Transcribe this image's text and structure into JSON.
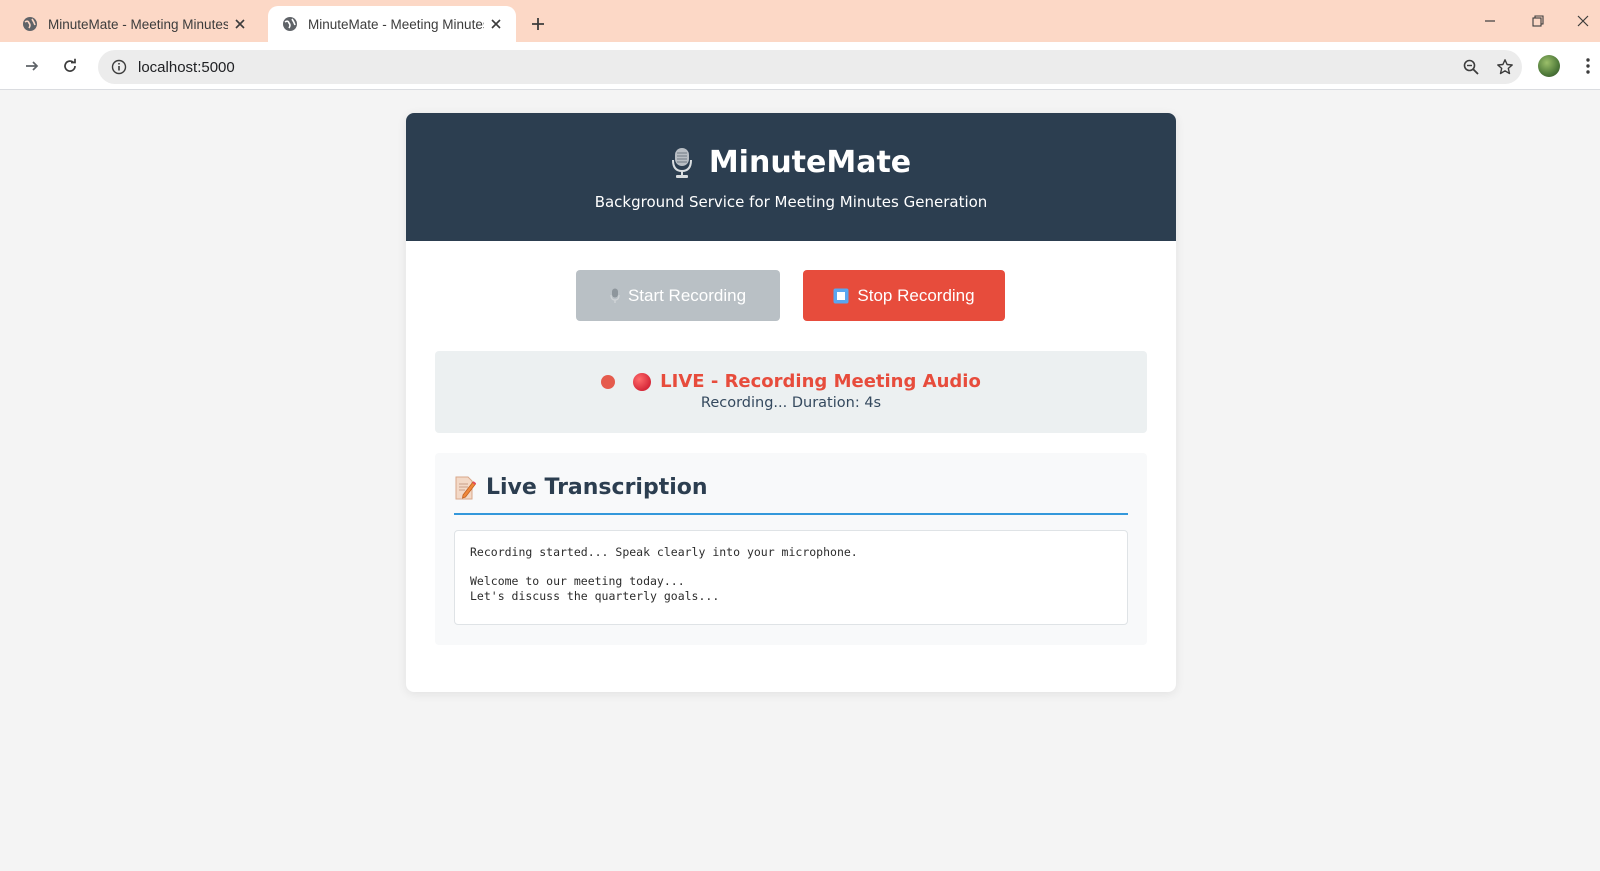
{
  "browser": {
    "tabs": [
      {
        "title": "MinuteMate - Meeting Minutes",
        "active": false
      },
      {
        "title": "MinuteMate - Meeting Minutes",
        "active": true
      }
    ],
    "url": "localhost:5000"
  },
  "app": {
    "title": "MinuteMate",
    "subtitle": "Background Service for Meeting Minutes Generation",
    "start_label": "Start Recording",
    "stop_label": "Stop Recording",
    "status": {
      "live_text": "LIVE - Recording Meeting Audio",
      "duration_text": "Recording... Duration: 4s"
    },
    "transcription": {
      "heading": "Live Transcription",
      "text": "Recording started... Speak clearly into your microphone.\n\nWelcome to our meeting today...\nLet's discuss the quarterly goals..."
    }
  },
  "colors": {
    "header_bg": "#2c3e50",
    "stop_button": "#e74c3c",
    "start_button_disabled": "#b9c0c5",
    "live_red": "#e74c3c",
    "accent_rule": "#3498db",
    "tabstrip": "#fcd8c6"
  },
  "icons": {
    "tab_favicon": "globe-icon",
    "title_icon": "microphone-icon",
    "start_icon": "microphone-icon",
    "stop_icon": "stop-square-icon",
    "heading_icon": "memo-icon"
  }
}
